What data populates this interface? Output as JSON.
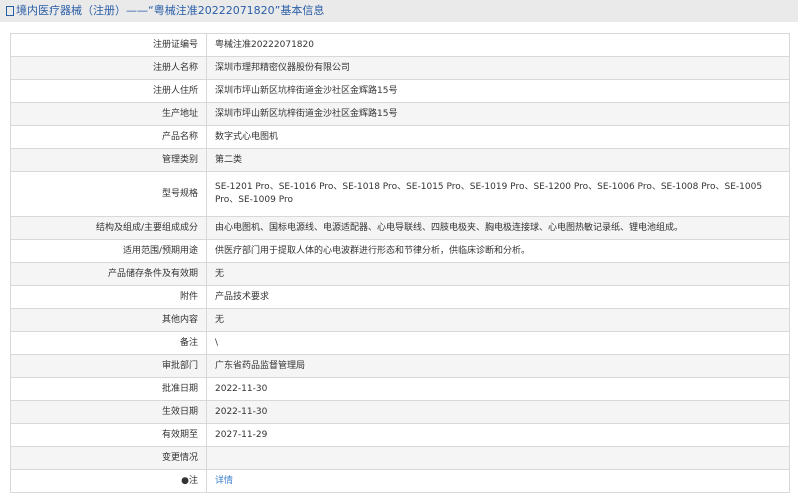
{
  "title": "境内医疗器械（注册）——“粤械注准20222071820”基本信息",
  "rows": [
    {
      "label": "注册证编号",
      "value": "粤械注准20222071820"
    },
    {
      "label": "注册人名称",
      "value": "深圳市理邦精密仪器股份有限公司"
    },
    {
      "label": "注册人住所",
      "value": "深圳市坪山新区坑梓街道金沙社区金辉路15号"
    },
    {
      "label": "生产地址",
      "value": "深圳市坪山新区坑梓街道金沙社区金辉路15号"
    },
    {
      "label": "产品名称",
      "value": "数字式心电图机"
    },
    {
      "label": "管理类别",
      "value": "第二类"
    },
    {
      "label": "型号规格",
      "value": "SE-1201 Pro、SE-1016 Pro、SE-1018 Pro、SE-1015 Pro、SE-1019 Pro、SE-1200 Pro、SE-1006 Pro、SE-1008 Pro、SE-1005 Pro、SE-1009 Pro"
    },
    {
      "label": "结构及组成/主要组成成分",
      "value": "由心电图机、国标电源线、电源适配器、心电导联线、四肢电极夹、胸电极连接球、心电图热敏记录纸、锂电池组成。"
    },
    {
      "label": "适用范围/预期用途",
      "value": "供医疗部门用于提取人体的心电波群进行形态和节律分析，供临床诊断和分析。"
    },
    {
      "label": "产品储存条件及有效期",
      "value": "无"
    },
    {
      "label": "附件",
      "value": "产品技术要求"
    },
    {
      "label": "其他内容",
      "value": "无"
    },
    {
      "label": "备注",
      "value": "\\"
    },
    {
      "label": "审批部门",
      "value": "广东省药品监督管理局"
    },
    {
      "label": "批准日期",
      "value": "2022-11-30"
    },
    {
      "label": "生效日期",
      "value": "2022-11-30"
    },
    {
      "label": "有效期至",
      "value": "2027-11-29"
    },
    {
      "label": "变更情况",
      "value": ""
    },
    {
      "label": "●注",
      "value": "详情"
    }
  ]
}
